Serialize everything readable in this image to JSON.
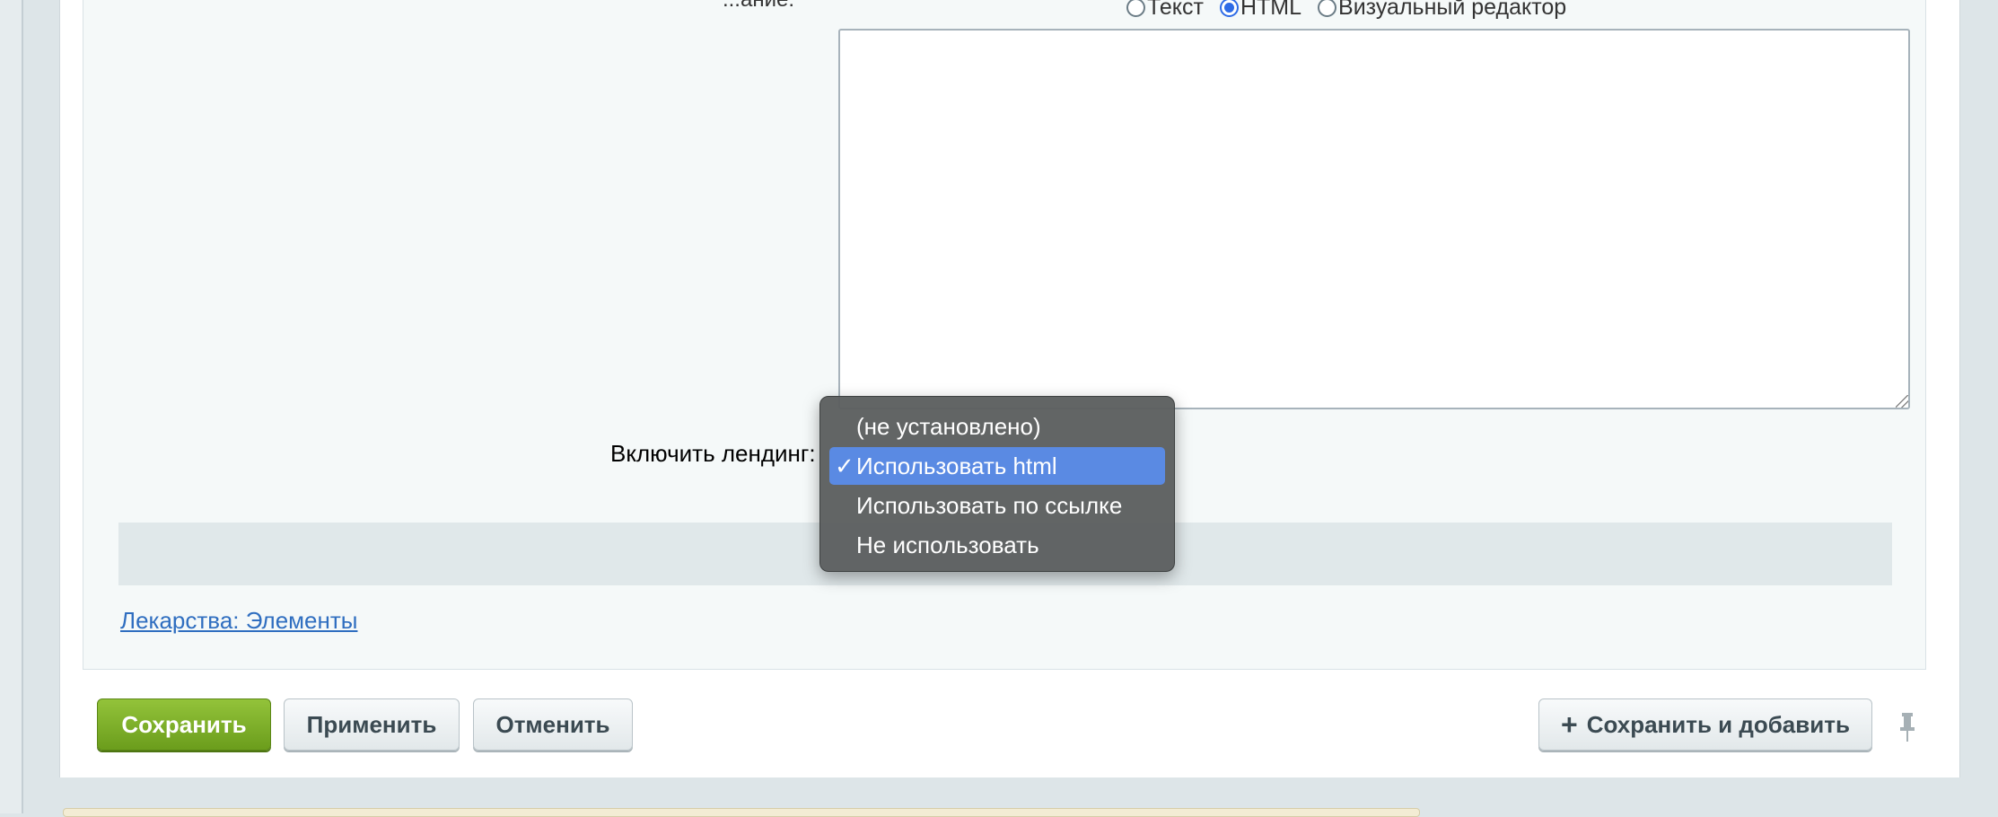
{
  "editor": {
    "radio_text": "Текст",
    "radio_html": "HTML",
    "radio_visual": "Визуальный редактор",
    "selected_mode": "HTML",
    "clipped_label": "...ание:",
    "content": ""
  },
  "landing": {
    "label": "Включить лендинг:",
    "options": [
      "(не установлено)",
      "Использовать html",
      "Использовать по ссылке",
      "Не использовать"
    ],
    "selected_index": 1,
    "check": "✓"
  },
  "breadcrumb": {
    "link": "Лекарства: Элементы"
  },
  "buttons": {
    "save": "Сохранить",
    "apply": "Применить",
    "cancel": "Отменить",
    "save_add": "Сохранить и добавить",
    "plus": "+"
  },
  "colors": {
    "save_green": "#7bb027",
    "dropdown_bg": "#5c5f5f",
    "dropdown_selected": "#5a8ae3",
    "link_blue": "#2f6ec0"
  }
}
